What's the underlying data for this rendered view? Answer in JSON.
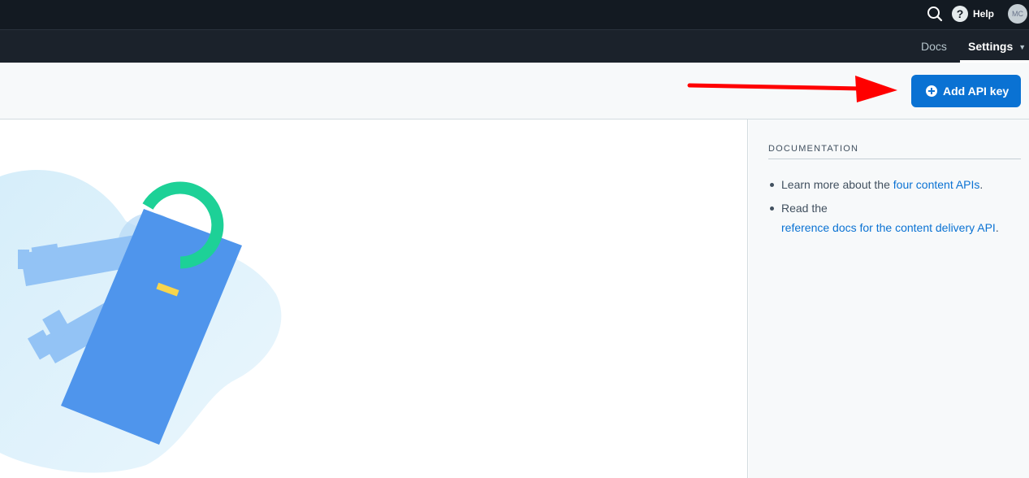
{
  "topbar": {
    "search_icon": "search-icon",
    "help_icon": "question-circle-icon",
    "help_label": "Help",
    "avatar_initials": "MC"
  },
  "navbar": {
    "docs_label": "Docs",
    "settings_label": "Settings",
    "settings_caret": "▼"
  },
  "toolbar": {
    "add_button_label": "Add API key",
    "add_button_icon": "plus-circle-icon",
    "accent_color": "#0a72d3"
  },
  "annotation": {
    "arrow_color": "#ff0000"
  },
  "sidebar": {
    "heading": "DOCUMENTATION",
    "items": [
      {
        "prefix": "Learn more about the ",
        "link": "four content APIs",
        "suffix": "."
      },
      {
        "prefix": "Read the ",
        "link": "reference docs for the content delivery API",
        "suffix": "."
      }
    ]
  },
  "colors": {
    "topbar_bg": "#131a22",
    "navbar_bg": "#1b222b",
    "toolbar_bg": "#f7f9fa",
    "link": "#0a72d3",
    "illustration_blue": "#4f95ec",
    "illustration_green": "#1dd197",
    "illustration_yellow": "#f7d54d"
  }
}
